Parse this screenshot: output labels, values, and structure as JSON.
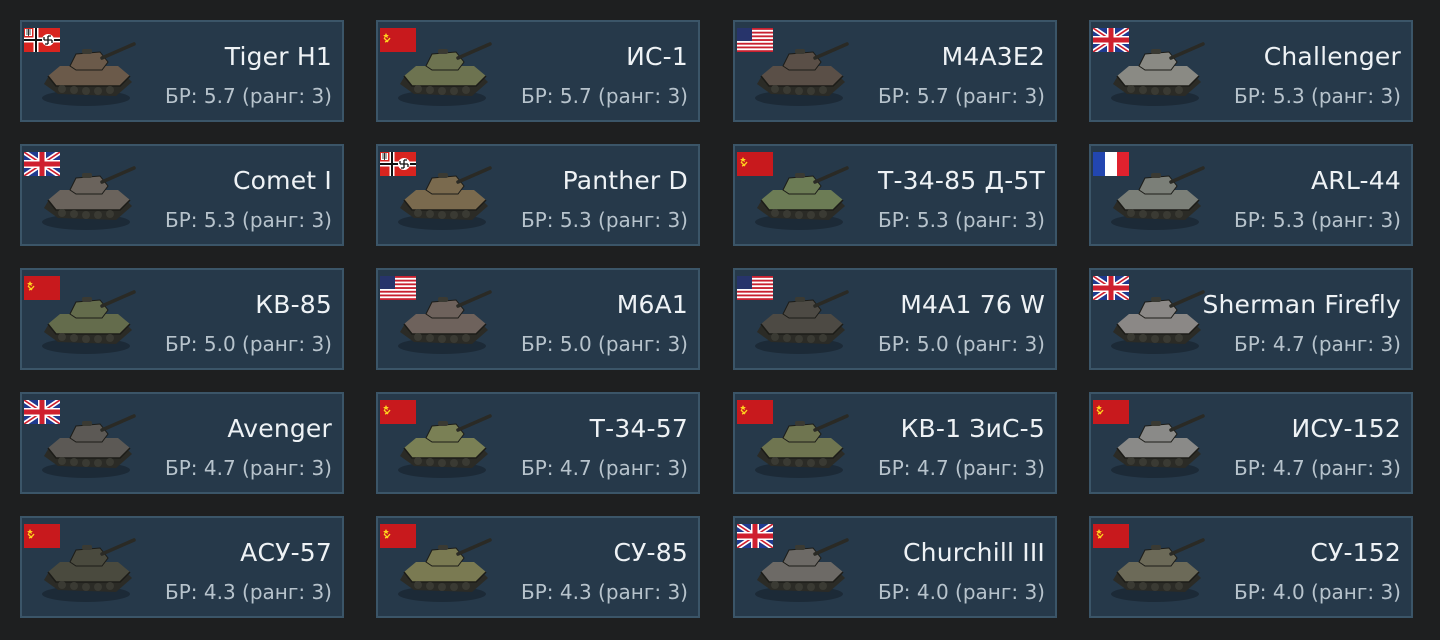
{
  "colors": {
    "background": "#1e1f20",
    "card_bg": "#26394a",
    "card_border": "#3b5568",
    "name_text": "#eef2f5",
    "br_text": "#b7c3cc"
  },
  "vehicles": [
    {
      "name": "Tiger H1",
      "br": "БР: 5.7 (ранг: 3)",
      "flag": "germany-flag-icon",
      "camo": "#6b5a4a"
    },
    {
      "name": "ИС-1",
      "br": "БР: 5.7 (ранг: 3)",
      "flag": "ussr-flag-icon",
      "camo": "#6d7350"
    },
    {
      "name": "M4A3E2",
      "br": "БР: 5.7 (ранг: 3)",
      "flag": "usa-flag-icon",
      "camo": "#5a4f47"
    },
    {
      "name": "Challenger",
      "br": "БР: 5.3 (ранг: 3)",
      "flag": "uk-flag-icon",
      "camo": "#8a8a84"
    },
    {
      "name": "Comet I",
      "br": "БР: 5.3 (ранг: 3)",
      "flag": "uk-flag-icon",
      "camo": "#6a635c"
    },
    {
      "name": "Panther D",
      "br": "БР: 5.3 (ранг: 3)",
      "flag": "germany-flag-icon",
      "camo": "#7a6a4e"
    },
    {
      "name": "Т-34-85 Д-5Т",
      "br": "БР: 5.3 (ранг: 3)",
      "flag": "ussr-flag-icon",
      "camo": "#6c7c55"
    },
    {
      "name": "ARL-44",
      "br": "БР: 5.3 (ранг: 3)",
      "flag": "france-flag-icon",
      "camo": "#7b7f78"
    },
    {
      "name": "КВ-85",
      "br": "БР: 5.0 (ранг: 3)",
      "flag": "ussr-flag-icon",
      "camo": "#646c4c"
    },
    {
      "name": "M6A1",
      "br": "БР: 5.0 (ранг: 3)",
      "flag": "usa-flag-icon",
      "camo": "#6e625c"
    },
    {
      "name": "M4A1 76 W",
      "br": "БР: 5.0 (ранг: 3)",
      "flag": "usa-flag-icon",
      "camo": "#4d4a44"
    },
    {
      "name": "Sherman Firefly",
      "br": "БР: 4.7 (ранг: 3)",
      "flag": "uk-flag-icon",
      "camo": "#8b8886"
    },
    {
      "name": "Avenger",
      "br": "БР: 4.7 (ранг: 3)",
      "flag": "uk-flag-icon",
      "camo": "#5c5955"
    },
    {
      "name": "Т-34-57",
      "br": "БР: 4.7 (ранг: 3)",
      "flag": "ussr-flag-icon",
      "camo": "#7a8055"
    },
    {
      "name": "КВ-1 ЗиС-5",
      "br": "БР: 4.7 (ранг: 3)",
      "flag": "ussr-flag-icon",
      "camo": "#6f7550"
    },
    {
      "name": "ИСУ-152",
      "br": "БР: 4.7 (ранг: 3)",
      "flag": "ussr-flag-icon",
      "camo": "#8a8a88"
    },
    {
      "name": "АСУ-57",
      "br": "БР: 4.3 (ранг: 3)",
      "flag": "ussr-flag-icon",
      "camo": "#4a4a3e"
    },
    {
      "name": "СУ-85",
      "br": "БР: 4.3 (ранг: 3)",
      "flag": "ussr-flag-icon",
      "camo": "#7a7a52"
    },
    {
      "name": "Churchill III",
      "br": "БР: 4.0 (ранг: 3)",
      "flag": "uk-flag-icon",
      "camo": "#6d6a66"
    },
    {
      "name": "СУ-152",
      "br": "БР: 4.0 (ранг: 3)",
      "flag": "ussr-flag-icon",
      "camo": "#6c6a58"
    }
  ]
}
